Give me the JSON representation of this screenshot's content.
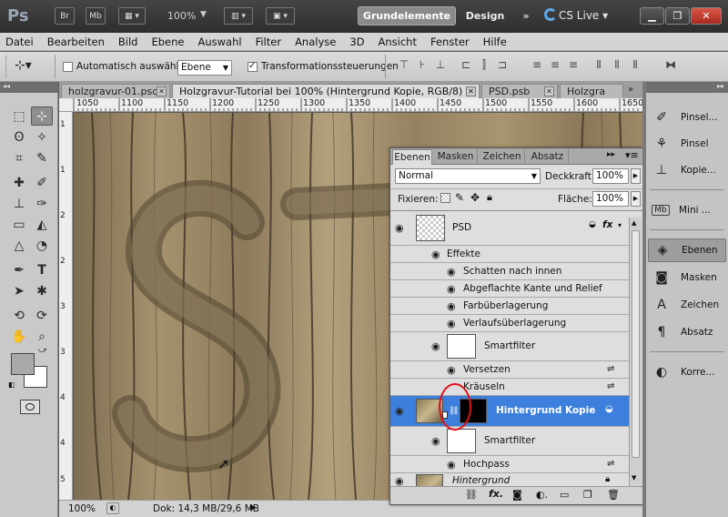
{
  "appbar": {
    "logo": "Ps",
    "br": "Br",
    "mb": "Mb",
    "zoom": "100%",
    "workspace_active": "Grundelemente",
    "workspace_design": "Design",
    "workspace_more": "»",
    "cs_live": "CS Live",
    "min": "▁",
    "restore": "❐",
    "close": "✕"
  },
  "menu": [
    "Datei",
    "Bearbeiten",
    "Bild",
    "Ebene",
    "Auswahl",
    "Filter",
    "Analyse",
    "3D",
    "Ansicht",
    "Fenster",
    "Hilfe"
  ],
  "options": {
    "auto_select_label": "Automatisch auswählen:",
    "auto_select_value": "Ebene",
    "transform_label": "Transformationssteuerungen"
  },
  "tabs": [
    {
      "label": "holzgravur-01.psd"
    },
    {
      "label": "Holzgravur-Tutorial bei 100% (Hintergrund Kopie, RGB/8) *"
    },
    {
      "label": "PSD.psb"
    },
    {
      "label": "Holzgra"
    }
  ],
  "ruler": {
    "top": [
      "1050",
      "1100",
      "1150",
      "1200",
      "1250",
      "1300",
      "1350",
      "1400",
      "1450",
      "1500",
      "1550",
      "1600",
      "1650"
    ],
    "left": [
      "1",
      "1",
      "2",
      "2",
      "3",
      "3",
      "4",
      "4",
      "5"
    ]
  },
  "status": {
    "zoom": "100%",
    "doc": "Dok: 14,3 MB/29,6 MB"
  },
  "layers_panel": {
    "tabs": [
      "Ebenen",
      "Masken",
      "Zeichen",
      "Absatz"
    ],
    "blend_mode": "Normal",
    "opacity_label": "Deckkraft:",
    "opacity_value": "100%",
    "lock_label": "Fixieren:",
    "fill_label": "Fläche:",
    "fill_value": "100%",
    "psd_layer": "PSD",
    "fx_symbol": "fx",
    "effects_label": "Effekte",
    "effects": [
      "Schatten nach innen",
      "Abgeflachte Kante und Relief",
      "Farbüberlagerung",
      "Verlaufsüberlagerung"
    ],
    "smartfilter_label": "Smartfilter",
    "filters_a": [
      "Versetzen",
      "Kräuseln"
    ],
    "selected_layer": "Hintergrund Kopie",
    "smartfilter_label_2": "Smartfilter",
    "filters_b": [
      "Hochpass"
    ],
    "background_layer": "Hintergrund"
  },
  "dock": {
    "items": [
      "Pinsel...",
      "Pinsel",
      "Kopie...",
      "Mini ...",
      "Ebenen",
      "Masken",
      "Zeichen",
      "Absatz",
      "Korre..."
    ],
    "active": "Ebenen"
  },
  "colors": {
    "selection": "#3d7fdc",
    "annotation_circle": "#e0101a"
  }
}
